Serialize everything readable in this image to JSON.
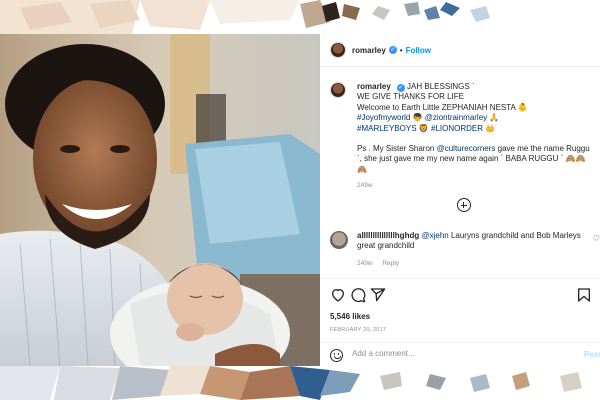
{
  "colors": {
    "link": "#0095f6",
    "tag": "#00376b",
    "muted": "#8e8e8e",
    "verified": "#3897f0"
  },
  "header": {
    "username": "romarley",
    "separator": "•",
    "follow_label": "Follow"
  },
  "caption": {
    "username": "romarley",
    "line1": "JAH BLESSINGS `",
    "line2": "WE GIVE THANKS FOR LIFE",
    "line3": "Welcome to Earth Little ZEPHANIAH NESTA 👶",
    "hashtag1": "#Joyofmyworld",
    "emoji1": "👦",
    "mention1": "@ziontrainmarley",
    "emoji2": "🙏",
    "hashtag2": "#MARLEYBOYS",
    "emoji3": "🦁",
    "hashtag3": "#LIONORDER",
    "emoji4": "👑",
    "ps_prefix": "Ps . My Sister Sharon ",
    "mention2": "@culturecorners",
    "ps_rest": " gave me the name Ruggu `, she just gave me my new name again ` BABA RUGGU ` 🙈🙈🙈",
    "time": "249w"
  },
  "comment": {
    "username": "alllllllllllllllhghdg",
    "mention": "@xjehn",
    "text": " Lauryns grandchild and Bob Marleys great grandchild",
    "time": "249w",
    "reply_label": "Reply"
  },
  "actions": {
    "likes": "5,546 likes",
    "date": "FEBRUARY 20, 2017"
  },
  "add_comment": {
    "placeholder": "Add a comment...",
    "post_label": "Post"
  },
  "icons": [
    "heart-icon",
    "comment-icon",
    "share-icon",
    "bookmark-icon",
    "emoji-icon",
    "add-icon",
    "verified-icon"
  ]
}
